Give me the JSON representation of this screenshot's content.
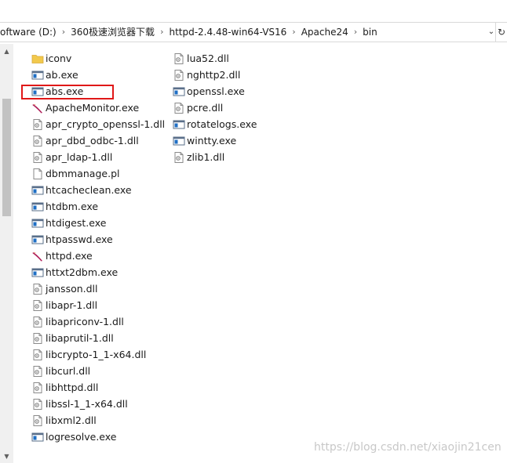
{
  "address_bar": {
    "crumbs": [
      "oftware (D:)",
      "360极速浏览器下载",
      "httpd-2.4.48-win64-VS16",
      "Apache24",
      "bin"
    ],
    "separator": "›",
    "dropdown_glyph": "⌄",
    "refresh_glyph": "↻"
  },
  "files": {
    "column1": [
      {
        "name": "iconv",
        "icon": "folder-icon"
      },
      {
        "name": "ab.exe",
        "icon": "exe-window-icon"
      },
      {
        "name": "abs.exe",
        "icon": "exe-window-icon"
      },
      {
        "name": "ApacheMonitor.exe",
        "icon": "apache-feather-icon"
      },
      {
        "name": "apr_crypto_openssl-1.dll",
        "icon": "dll-file-icon"
      },
      {
        "name": "apr_dbd_odbc-1.dll",
        "icon": "dll-file-icon"
      },
      {
        "name": "apr_ldap-1.dll",
        "icon": "dll-file-icon"
      },
      {
        "name": "dbmmanage.pl",
        "icon": "generic-file-icon"
      },
      {
        "name": "htcacheclean.exe",
        "icon": "exe-window-icon"
      },
      {
        "name": "htdbm.exe",
        "icon": "exe-window-icon"
      },
      {
        "name": "htdigest.exe",
        "icon": "exe-window-icon"
      },
      {
        "name": "htpasswd.exe",
        "icon": "exe-window-icon"
      },
      {
        "name": "httpd.exe",
        "icon": "apache-feather-icon"
      },
      {
        "name": "httxt2dbm.exe",
        "icon": "exe-window-icon"
      },
      {
        "name": "jansson.dll",
        "icon": "dll-file-icon"
      },
      {
        "name": "libapr-1.dll",
        "icon": "dll-file-icon"
      },
      {
        "name": "libapriconv-1.dll",
        "icon": "dll-file-icon"
      },
      {
        "name": "libaprutil-1.dll",
        "icon": "dll-file-icon"
      },
      {
        "name": "libcrypto-1_1-x64.dll",
        "icon": "dll-file-icon"
      },
      {
        "name": "libcurl.dll",
        "icon": "dll-file-icon"
      },
      {
        "name": "libhttpd.dll",
        "icon": "dll-file-icon"
      },
      {
        "name": "libssl-1_1-x64.dll",
        "icon": "dll-file-icon"
      },
      {
        "name": "libxml2.dll",
        "icon": "dll-file-icon"
      },
      {
        "name": "logresolve.exe",
        "icon": "exe-window-icon"
      }
    ],
    "column2": [
      {
        "name": "lua52.dll",
        "icon": "dll-file-icon"
      },
      {
        "name": "nghttp2.dll",
        "icon": "dll-file-icon"
      },
      {
        "name": "openssl.exe",
        "icon": "exe-window-icon"
      },
      {
        "name": "pcre.dll",
        "icon": "dll-file-icon"
      },
      {
        "name": "rotatelogs.exe",
        "icon": "exe-window-icon"
      },
      {
        "name": "wintty.exe",
        "icon": "exe-window-icon"
      },
      {
        "name": "zlib1.dll",
        "icon": "dll-file-icon"
      }
    ]
  },
  "highlighted_item": "abs.exe",
  "colors": {
    "highlight": "#e01818",
    "folder": "#f2c94c",
    "exe_blue": "#1f6fc5",
    "feather": "#b0235c"
  },
  "scrollbar": {
    "up_glyph": "▲",
    "down_glyph": "▼"
  },
  "watermark": "https://blog.csdn.net/xiaojin21cen"
}
